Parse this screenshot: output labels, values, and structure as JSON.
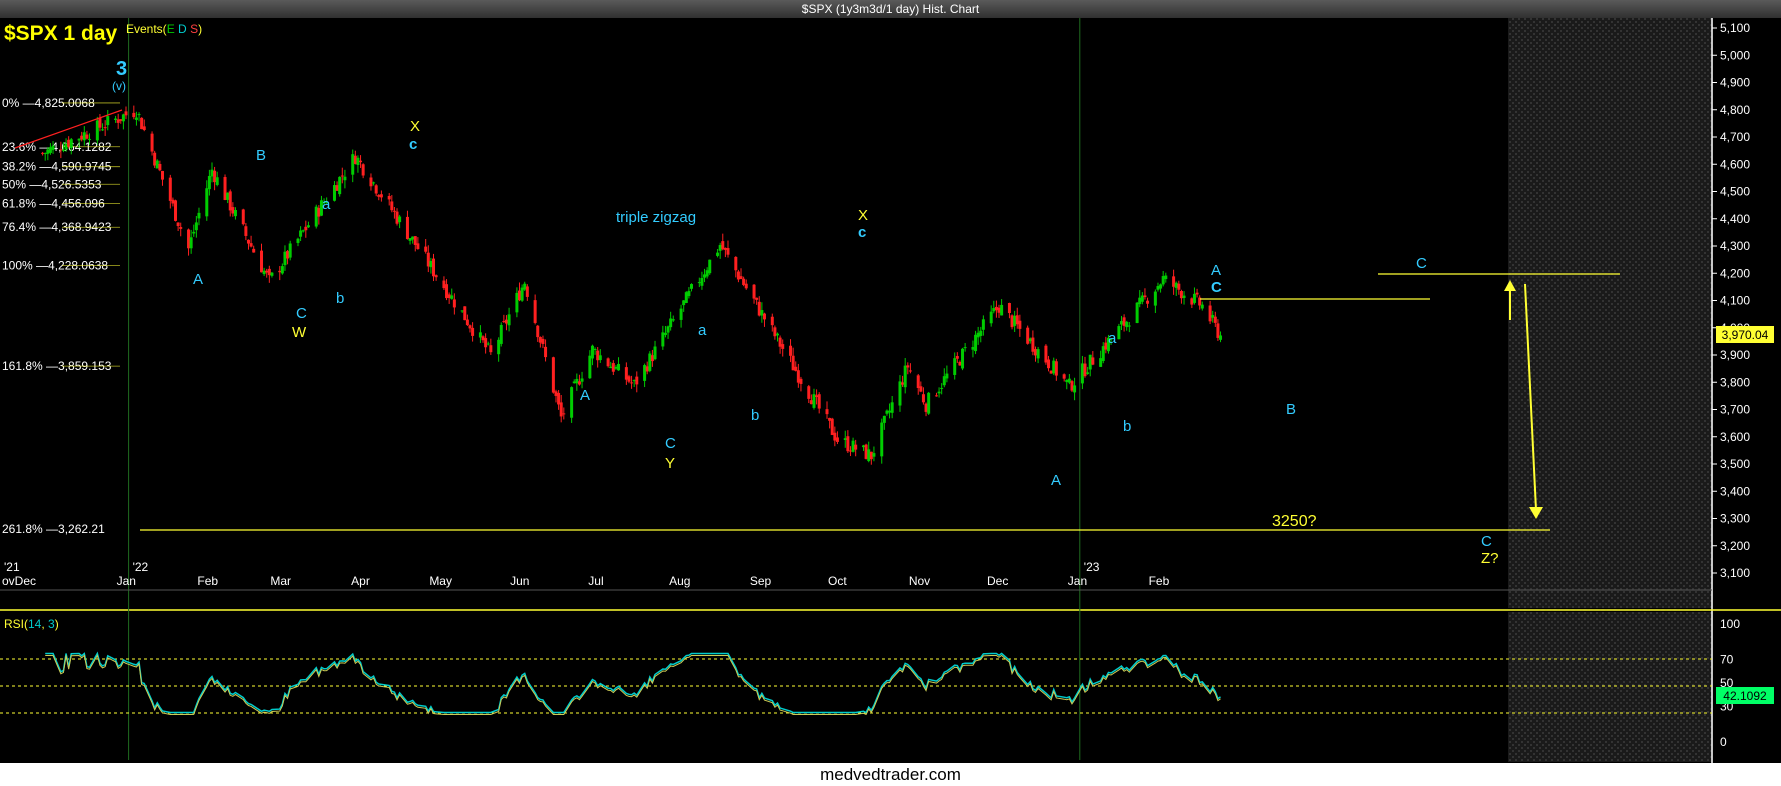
{
  "window_title": "$SPX (1y3m3d/1 day) Hist. Chart",
  "footer_text": "medvedtrader.com",
  "header": {
    "symbol": "$SPX 1 day",
    "events_label": "Events(",
    "events_letters": [
      "E",
      "D",
      "S"
    ],
    "events_close": ")"
  },
  "colors": {
    "up": "#00cc00",
    "down": "#ff2020",
    "wave_cyan": "#33ccff",
    "wave_yellow": "#ffff33",
    "axis": "#ffffff",
    "rsi": "#00cccc",
    "rsi_signal": "#cccc55"
  },
  "price_axis_labels": [
    "5,100",
    "5,000",
    "4,900",
    "4,800",
    "4,700",
    "4,600",
    "4,500",
    "4,400",
    "4,300",
    "4,200",
    "4,100",
    "4,000",
    "3,900",
    "3,800",
    "3,700",
    "3,600",
    "3,500",
    "3,400",
    "3,300",
    "3,200",
    "3,100"
  ],
  "last_price": "3,970.04",
  "time_axis": {
    "year_labels": [
      "'21",
      "'22",
      "'23"
    ],
    "month_labels": [
      "ovDec",
      "Jan",
      "Feb",
      "Mar",
      "Apr",
      "May",
      "Jun",
      "Jul",
      "Aug",
      "Sep",
      "Oct",
      "Nov",
      "Dec",
      "Jan",
      "Feb"
    ]
  },
  "fib_levels": [
    {
      "pct": "0%",
      "value": "4,825.0068"
    },
    {
      "pct": "23.6%",
      "value": "4,664.1282"
    },
    {
      "pct": "38.2%",
      "value": "4,590.9745"
    },
    {
      "pct": "50%",
      "value": "4,526.5353"
    },
    {
      "pct": "61.8%",
      "value": "4,456.096"
    },
    {
      "pct": "76.4%",
      "value": "4,368.9423"
    },
    {
      "pct": "100%",
      "value": "4,228.0638"
    },
    {
      "pct": "161.8%",
      "value": "3,859.153"
    },
    {
      "pct": "261.8%",
      "value": "3,262.21"
    }
  ],
  "wave_labels": [
    "3",
    "(v)",
    "A",
    "B",
    "C",
    "W",
    "a",
    "b",
    "X",
    "c",
    "A",
    "C",
    "Y",
    "a",
    "b",
    "X",
    "c",
    "a",
    "b",
    "A",
    "A",
    "C",
    "B",
    "C",
    "C",
    "Z?",
    "triple zigzag",
    "3250?"
  ],
  "rsi": {
    "label": "RSI(",
    "period": "14",
    "smooth": "3",
    "close": ")",
    "value": "42.1092",
    "levels": [
      "100",
      "70",
      "50",
      "30",
      "0"
    ]
  },
  "chart_data": {
    "type": "candlestick",
    "title": "$SPX 1 day",
    "ylim": [
      3050,
      5130
    ],
    "key_points": [
      {
        "date": "2021-11-29",
        "close": 4640
      },
      {
        "date": "2022-01-04",
        "close": 4800
      },
      {
        "date": "2022-01-24",
        "close": 4290
      },
      {
        "date": "2022-02-02",
        "close": 4580
      },
      {
        "date": "2022-02-24",
        "close": 4170
      },
      {
        "date": "2022-03-29",
        "close": 4630
      },
      {
        "date": "2022-05-20",
        "close": 3900
      },
      {
        "date": "2022-06-02",
        "close": 4170
      },
      {
        "date": "2022-06-16",
        "close": 3670
      },
      {
        "date": "2022-06-28",
        "close": 3920
      },
      {
        "date": "2022-07-14",
        "close": 3790
      },
      {
        "date": "2022-08-16",
        "close": 4305
      },
      {
        "date": "2022-09-30",
        "close": 3590
      },
      {
        "date": "2022-10-13",
        "close": 3530
      },
      {
        "date": "2022-10-27",
        "close": 3860
      },
      {
        "date": "2022-11-03",
        "close": 3720
      },
      {
        "date": "2022-12-01",
        "close": 4080
      },
      {
        "date": "2022-12-28",
        "close": 3785
      },
      {
        "date": "2023-02-02",
        "close": 4180
      },
      {
        "date": "2023-02-17",
        "close": 4080
      },
      {
        "date": "2023-02-24",
        "close": 3970
      }
    ],
    "horizontal_lines": [
      {
        "value": 4205,
        "label": ""
      },
      {
        "value": 4115,
        "label": ""
      },
      {
        "value": 3262.21,
        "label": "3250?"
      }
    ],
    "projection_arrows": [
      {
        "from": 4000,
        "to": 4180,
        "direction": "up"
      },
      {
        "from": 4200,
        "to": 3330,
        "direction": "down"
      }
    ]
  }
}
